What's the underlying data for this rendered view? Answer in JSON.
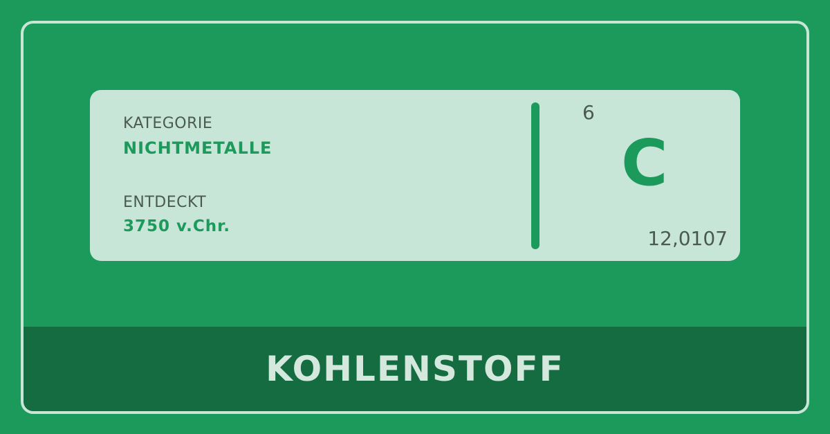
{
  "element": {
    "category_label": "KATEGORIE",
    "category_value": "NICHTMETALLE",
    "discovered_label": "ENTDECKT",
    "discovered_value": "3750 v.Chr.",
    "atomic_number": "6",
    "symbol": "C",
    "atomic_mass": "12,0107",
    "name": "KOHLENSTOFF"
  },
  "colors": {
    "background": "#1b9a5b",
    "card": "#c8e6d8",
    "footer": "#146c40",
    "accent": "#1b9a5b",
    "text_muted": "#4a5a52"
  }
}
